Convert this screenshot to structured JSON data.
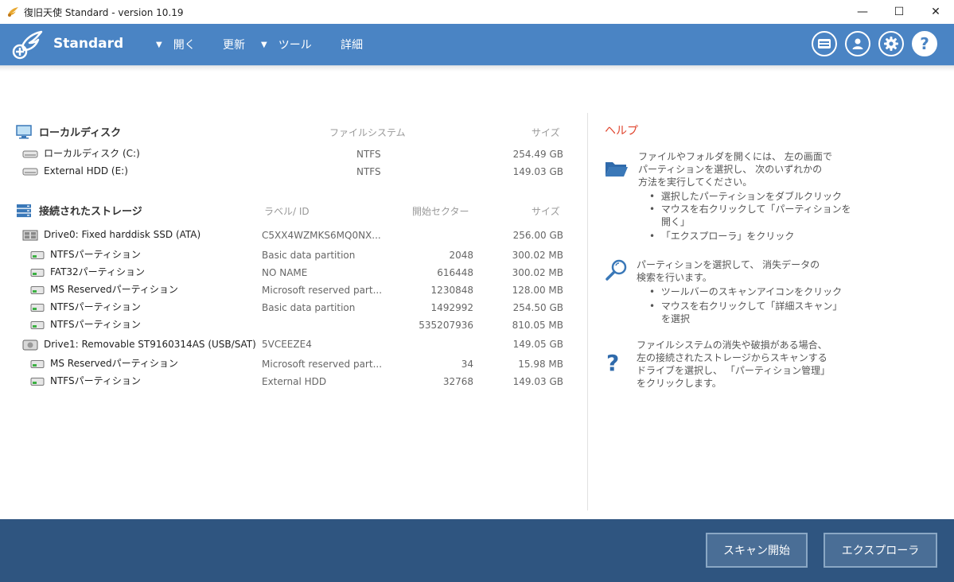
{
  "window": {
    "title": "復旧天使 Standard - version 10.19",
    "minimize": "—",
    "maximize": "☐",
    "close": "✕"
  },
  "toolbar": {
    "brand": "Standard",
    "menu": [
      "開く",
      "更新",
      "ツール",
      "詳細"
    ]
  },
  "local_disk": {
    "title": "ローカルディスク",
    "col_fs": "ファイルシステム",
    "col_size": "サイズ",
    "items": [
      {
        "name": "ローカルディスク (C:)",
        "fs": "NTFS",
        "size": "254.49 GB"
      },
      {
        "name": "External HDD (E:)",
        "fs": "NTFS",
        "size": "149.03 GB"
      }
    ]
  },
  "storage": {
    "title": "接続されたストレージ",
    "col_label": "ラベル/ ID",
    "col_start": "開始セクター",
    "col_size": "サイズ",
    "drives": [
      {
        "name": "Drive0: Fixed harddisk SSD (ATA)",
        "label": "C5XX4WZMKS6MQ0NX...",
        "start": "",
        "size": "256.00 GB"
      },
      {
        "name": "NTFSパーティション",
        "label": "Basic data partition",
        "start": "2048",
        "size": "300.02 MB"
      },
      {
        "name": "FAT32パーティション",
        "label": "NO NAME",
        "start": "616448",
        "size": "300.02 MB"
      },
      {
        "name": "MS Reservedパーティション",
        "label": "Microsoft reserved part...",
        "start": "1230848",
        "size": "128.00 MB"
      },
      {
        "name": "NTFSパーティション",
        "label": "Basic data partition",
        "start": "1492992",
        "size": "254.50 GB"
      },
      {
        "name": "NTFSパーティション",
        "label": "",
        "start": "535207936",
        "size": "810.05 MB"
      },
      {
        "name": "Drive1: Removable ST9160314AS (USB/SAT)",
        "label": "5VCEEZE4",
        "start": "",
        "size": "149.05 GB"
      },
      {
        "name": "MS Reservedパーティション",
        "label": "Microsoft reserved part...",
        "start": "34",
        "size": "15.98 MB"
      },
      {
        "name": "NTFSパーティション",
        "label": "External HDD",
        "start": "32768",
        "size": "149.03 GB"
      }
    ]
  },
  "help": {
    "title": "ヘルプ",
    "block1_lines": [
      "ファイルやフォルダを開くには、 左の画面で",
      "パーティションを選択し、 次のいずれかの",
      "方法を実行してください。"
    ],
    "block1_bullets": [
      "選択したパーティションをダブルクリック",
      "マウスを右クリックして「パーティションを",
      "開く」",
      "「エクスプローラ」をクリック"
    ],
    "block2_lines": [
      "パーティションを選択して、 消失データの",
      "検索を行います。"
    ],
    "block2_bullets": [
      "ツールバーのスキャンアイコンをクリック",
      "マウスを右クリックして「詳細スキャン」",
      "を選択"
    ],
    "block3_lines": [
      "ファイルシステムの消失や破損がある場合、",
      "左の接続されたストレージからスキャンする",
      "ドライブを選択し、 「パーティション管理」",
      "をクリックします。"
    ]
  },
  "buttons": {
    "scan": "スキャン開始",
    "explorer": "エクスプローラ"
  }
}
